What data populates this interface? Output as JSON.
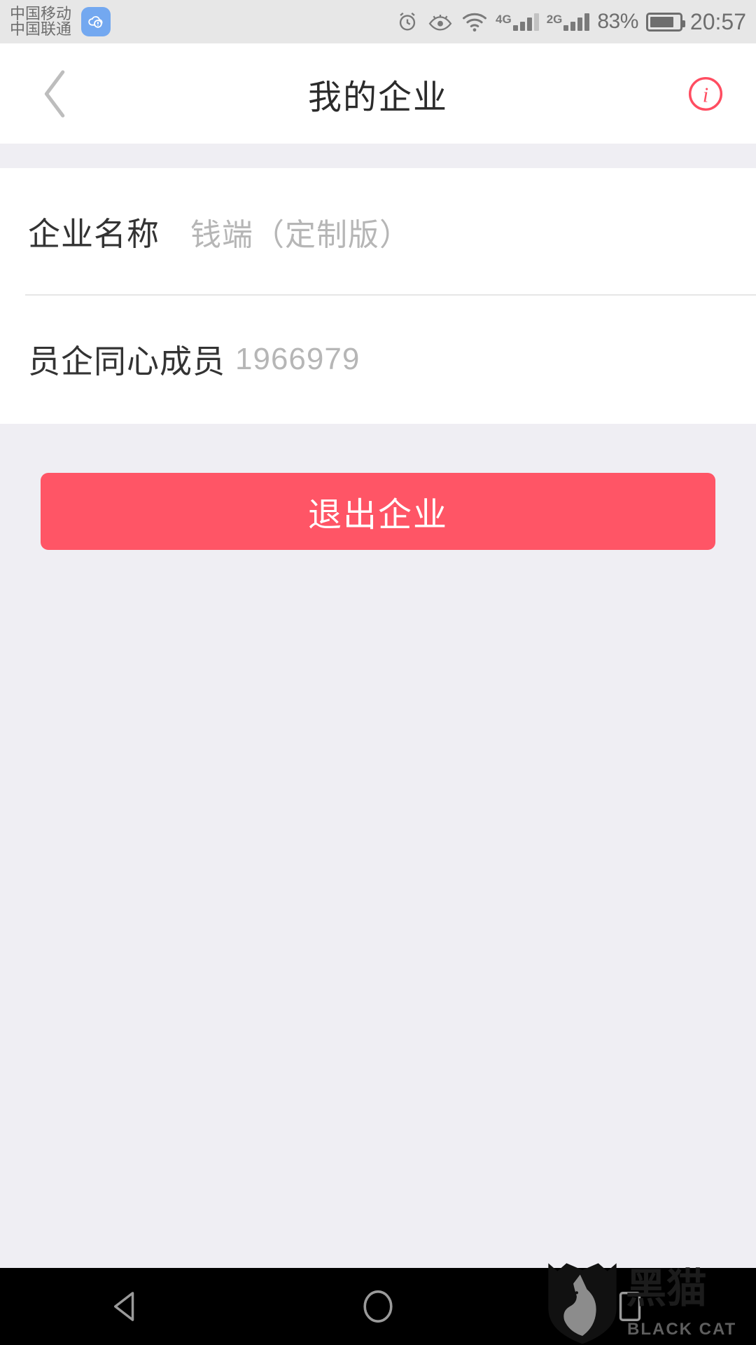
{
  "status_bar": {
    "carrier_primary": "中国移动",
    "carrier_secondary": "中国联通",
    "cloud_icon": "cloud-alert-icon",
    "alarm_icon": "alarm-clock-icon",
    "eye_icon": "eye-icon",
    "wifi_icon": "wifi-icon",
    "network_primary": "4G",
    "network_secondary": "2G",
    "battery_percent": "83%",
    "battery_level": 83,
    "time": "20:57"
  },
  "header": {
    "back_icon": "chevron-left-icon",
    "title": "我的企业",
    "info_icon": "info-circle-icon",
    "info_color": "#FF4D61"
  },
  "card": {
    "rows": [
      {
        "label": "企业名称",
        "value": "钱端（定制版）",
        "value_style": "spaced"
      },
      {
        "label": "员企同心成员",
        "value": "1966979",
        "value_style": "tight"
      }
    ]
  },
  "actions": {
    "exit_label": "退出企业",
    "exit_color": "#FF5566"
  },
  "navbar": {
    "back_icon": "triangle-back-icon",
    "home_icon": "circle-home-icon",
    "recents_icon": "square-recents-icon"
  },
  "watermark": {
    "logo_icon": "black-cat-shield-icon",
    "name_cn": "黑猫",
    "name_en": "BLACK CAT"
  }
}
